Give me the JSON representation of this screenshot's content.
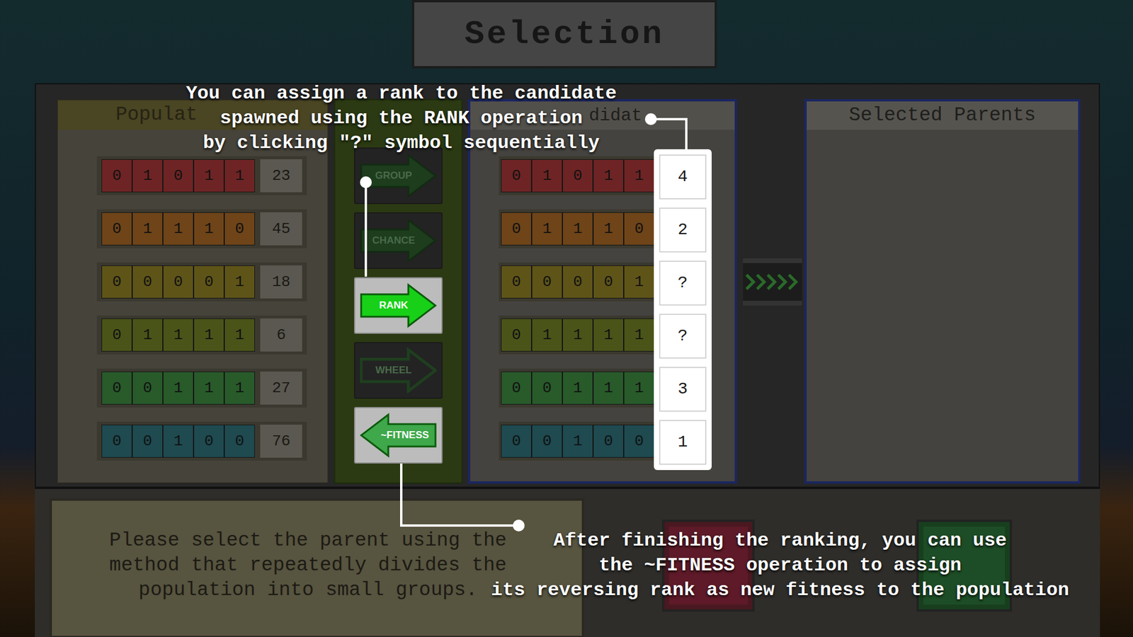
{
  "title": "Selection",
  "population": {
    "header": "Populat",
    "rows": [
      {
        "bits": [
          "0",
          "1",
          "0",
          "1",
          "1"
        ],
        "fitness": "23",
        "color": "#6e2424"
      },
      {
        "bits": [
          "0",
          "1",
          "1",
          "1",
          "0"
        ],
        "fitness": "45",
        "color": "#6e4418"
      },
      {
        "bits": [
          "0",
          "0",
          "0",
          "0",
          "1"
        ],
        "fitness": "18",
        "color": "#5e5418"
      },
      {
        "bits": [
          "0",
          "1",
          "1",
          "1",
          "1"
        ],
        "fitness": "6",
        "color": "#4a5418"
      },
      {
        "bits": [
          "0",
          "0",
          "1",
          "1",
          "1"
        ],
        "fitness": "27",
        "color": "#285a2a"
      },
      {
        "bits": [
          "0",
          "0",
          "1",
          "0",
          "0"
        ],
        "fitness": "76",
        "color": "#1e4a50"
      }
    ]
  },
  "operations": [
    {
      "label": "GROUP",
      "kind": "right",
      "highlighted": false
    },
    {
      "label": "CHANCE",
      "kind": "right",
      "highlighted": false
    },
    {
      "label": "RANK",
      "kind": "right",
      "highlighted": true
    },
    {
      "label": "WHEEL",
      "kind": "outline",
      "highlighted": false
    },
    {
      "label": "~FITNESS",
      "kind": "left",
      "highlighted": true
    }
  ],
  "candidates": {
    "header": "didat",
    "rows": [
      {
        "bits": [
          "0",
          "1",
          "0",
          "1",
          "1"
        ],
        "rank": "4",
        "color": "#6e2424"
      },
      {
        "bits": [
          "0",
          "1",
          "1",
          "1",
          "0"
        ],
        "rank": "2",
        "color": "#6e4418"
      },
      {
        "bits": [
          "0",
          "0",
          "0",
          "0",
          "1"
        ],
        "rank": "?",
        "color": "#5e5418"
      },
      {
        "bits": [
          "0",
          "1",
          "1",
          "1",
          "1"
        ],
        "rank": "?",
        "color": "#4a5418"
      },
      {
        "bits": [
          "0",
          "0",
          "1",
          "1",
          "1"
        ],
        "rank": "3",
        "color": "#285a2a"
      },
      {
        "bits": [
          "0",
          "0",
          "1",
          "0",
          "0"
        ],
        "rank": "1",
        "color": "#1e4a50"
      }
    ]
  },
  "selected_parents": {
    "header": "Selected Parents"
  },
  "instruction": [
    "Please select the parent using the",
    "method that repeatedly divides the",
    "population into small groups."
  ],
  "tutorial": {
    "top": [
      "You can assign a rank to the candidate",
      "spawned using the RANK operation",
      "by clicking \"?\" symbol sequentially"
    ],
    "bottom": [
      "After finishing the ranking, you can use",
      "the ~FITNESS operation to assign",
      "its reversing rank as new fitness to the population"
    ]
  }
}
